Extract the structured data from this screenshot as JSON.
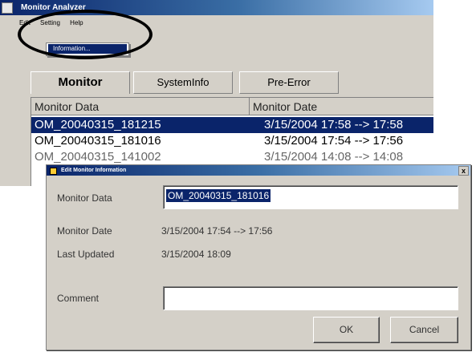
{
  "main": {
    "title": "Monitor Analyzer",
    "menu": [
      "Edit",
      "Setting",
      "Help"
    ],
    "dropdown_item": "Information...",
    "tabs": [
      "Monitor",
      "SystemInfo",
      "Pre-Error"
    ],
    "columns": [
      "Monitor Data",
      "Monitor Date"
    ],
    "rows": [
      {
        "data": "OM_20040315_181215",
        "date": "3/15/2004 17:58 --> 17:58",
        "selected": true
      },
      {
        "data": "OM_20040315_181016",
        "date": "3/15/2004 17:54 --> 17:56",
        "selected": false
      },
      {
        "data": "OM_20040315_141002",
        "date": "3/15/2004 14:08 --> 14:08",
        "selected": false
      }
    ]
  },
  "dialog": {
    "title": "Edit Monitor Information",
    "close_glyph": "x",
    "monitor_data_label": "Monitor Data",
    "monitor_data_value": "OM_20040315_181016",
    "monitor_date_label": "Monitor Date",
    "monitor_date_value": "3/15/2004 17:54 --> 17:56",
    "last_updated_label": "Last Updated",
    "last_updated_value": "3/15/2004 18:09",
    "comment_label": "Comment",
    "comment_value": "",
    "ok_label": "OK",
    "cancel_label": "Cancel"
  },
  "colors": {
    "selection": "#0a246a",
    "window_face": "#d4d0c8",
    "highlight_ring": "#000000"
  }
}
